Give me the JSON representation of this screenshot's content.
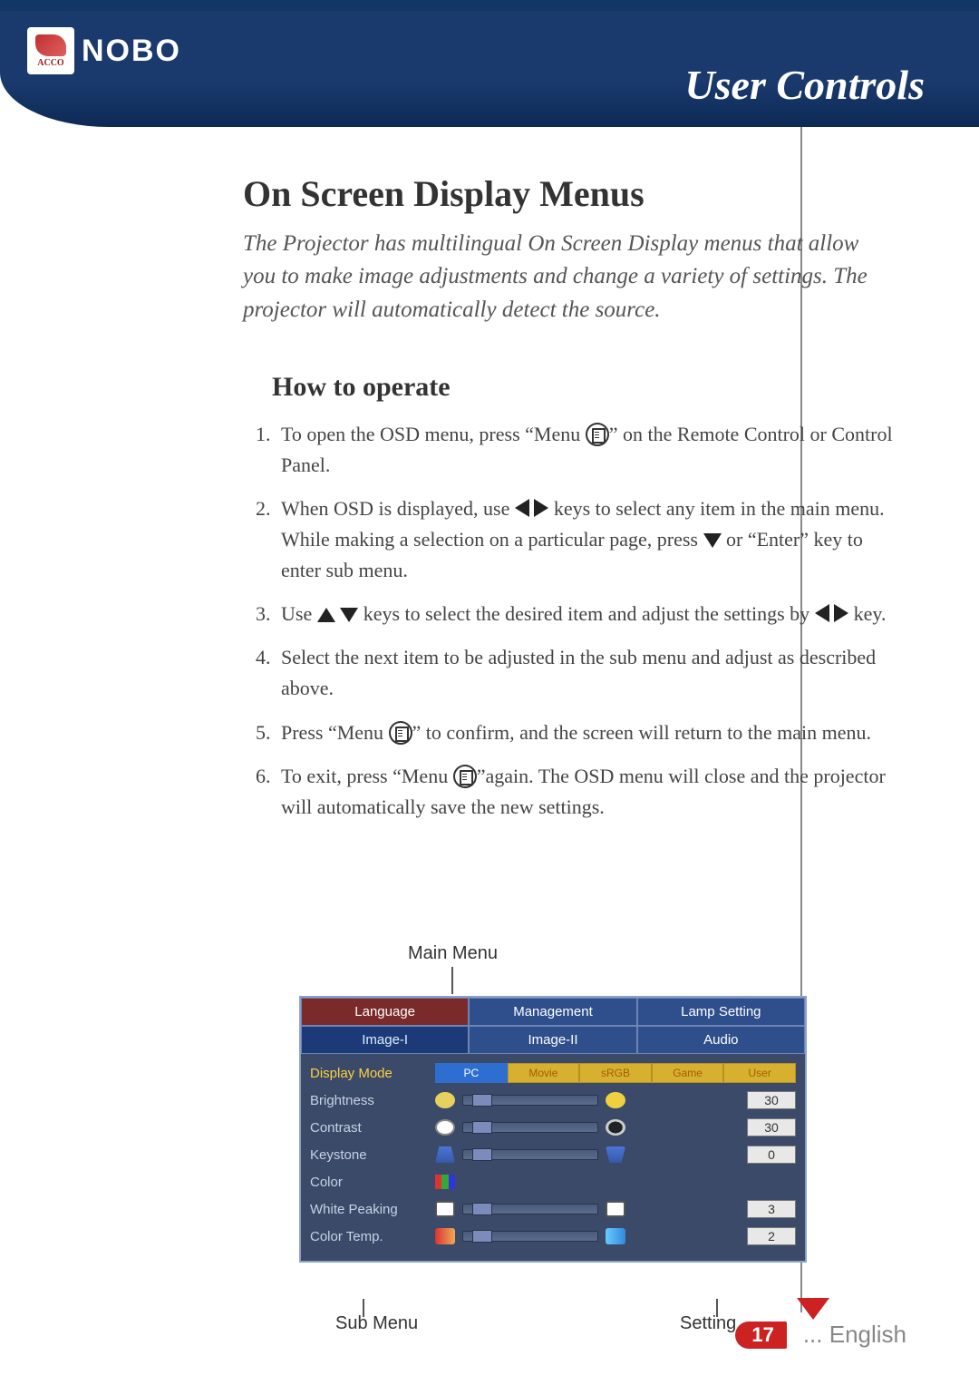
{
  "brand": {
    "parent": "ACCO",
    "name": "NOBO"
  },
  "header_title": "User Controls",
  "section_title": "On Screen Display Menus",
  "intro": "The Projector has multilingual On Screen Display menus that allow you to make image adjustments and change a variety of settings. The projector will automatically detect the source.",
  "subheading": "How to operate",
  "steps": {
    "s1a": "To open the OSD menu, press “Menu ",
    "s1b": "” on the Remote Control or Control Panel.",
    "s2a": "When OSD is displayed, use ",
    "s2b": " keys to select any item in the main menu.  While making a selection on a particular page, press ",
    "s2c": " or “Enter” key to enter sub menu.",
    "s3a": "Use ",
    "s3b": " keys to select the desired item and adjust the settings by ",
    "s3c": " key.",
    "s4": "Select the next item to be adjusted in the sub menu and adjust as described above.",
    "s5a": "Press “Menu ",
    "s5b": "” to confirm, and the screen will return to the main menu.",
    "s6a": "To exit, press “Menu ",
    "s6b": "”again.  The OSD menu will close and the projector will automatically save the new settings."
  },
  "figure": {
    "main_menu_label": "Main Menu",
    "sub_menu_label": "Sub Menu",
    "setting_label": "Setting",
    "tabs_row1": {
      "c1": "Language",
      "c2": "Management",
      "c3": "Lamp Setting"
    },
    "tabs_row2": {
      "c1": "Image-I",
      "c2": "Image-II",
      "c3": "Audio"
    },
    "modes": {
      "m1": "PC",
      "m2": "Movie",
      "m3": "sRGB",
      "m4": "Game",
      "m5": "User"
    },
    "rows": {
      "display_mode": "Display Mode",
      "brightness": "Brightness",
      "contrast": "Contrast",
      "keystone": "Keystone",
      "color": "Color",
      "white_peaking": "White Peaking",
      "color_temp": "Color Temp."
    },
    "values": {
      "brightness": "30",
      "contrast": "30",
      "keystone": "0",
      "white_peaking": "3",
      "color_temp": "2"
    }
  },
  "footer": {
    "page": "17",
    "lang": "... English"
  }
}
